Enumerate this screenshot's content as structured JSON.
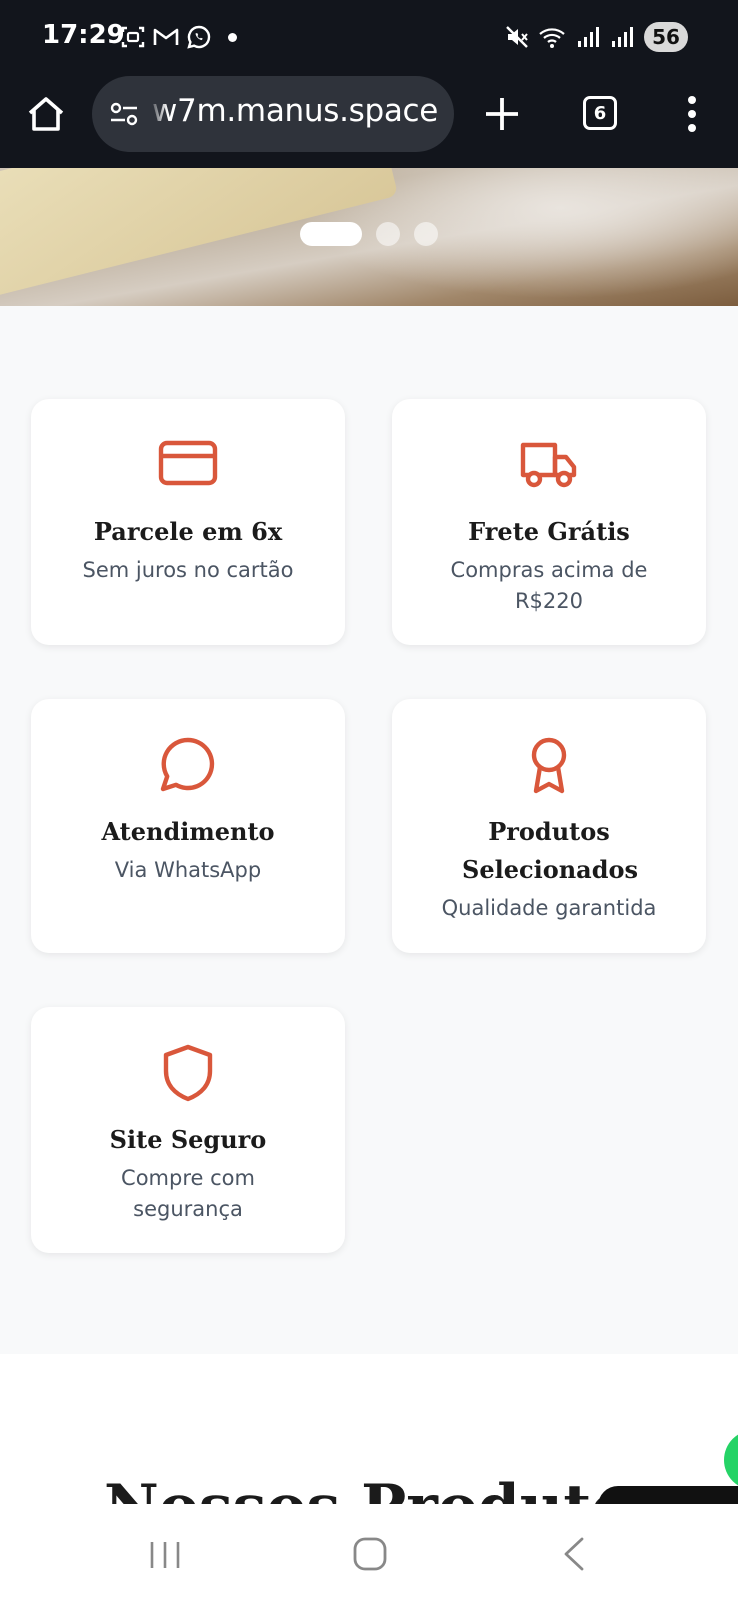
{
  "status_bar": {
    "time": "17:29",
    "battery": "56"
  },
  "browser": {
    "url": "w7m.manus.space",
    "tab_count": "6"
  },
  "hero": {
    "carousel_slides": 3,
    "active_slide": 1
  },
  "features": [
    {
      "icon": "credit-card-icon",
      "title": "Parcele em 6x",
      "subtitle": "Sem juros no cartão"
    },
    {
      "icon": "truck-icon",
      "title": "Frete Grátis",
      "subtitle": "Compras acima de R$220"
    },
    {
      "icon": "chat-bubble-icon",
      "title": "Atendimento",
      "subtitle": "Via WhatsApp"
    },
    {
      "icon": "award-ribbon-icon",
      "title": "Produtos Selecionados",
      "subtitle": "Qualidade garantida"
    },
    {
      "icon": "shield-icon",
      "title": "Site Seguro",
      "subtitle": "Compre com segurança"
    }
  ],
  "products": {
    "heading": "Nossos Produtos"
  },
  "colors": {
    "accent": "#d9573b",
    "chrome_bg": "#12151c",
    "page_bg": "#f8f9fa",
    "whatsapp_green": "#25d366"
  }
}
